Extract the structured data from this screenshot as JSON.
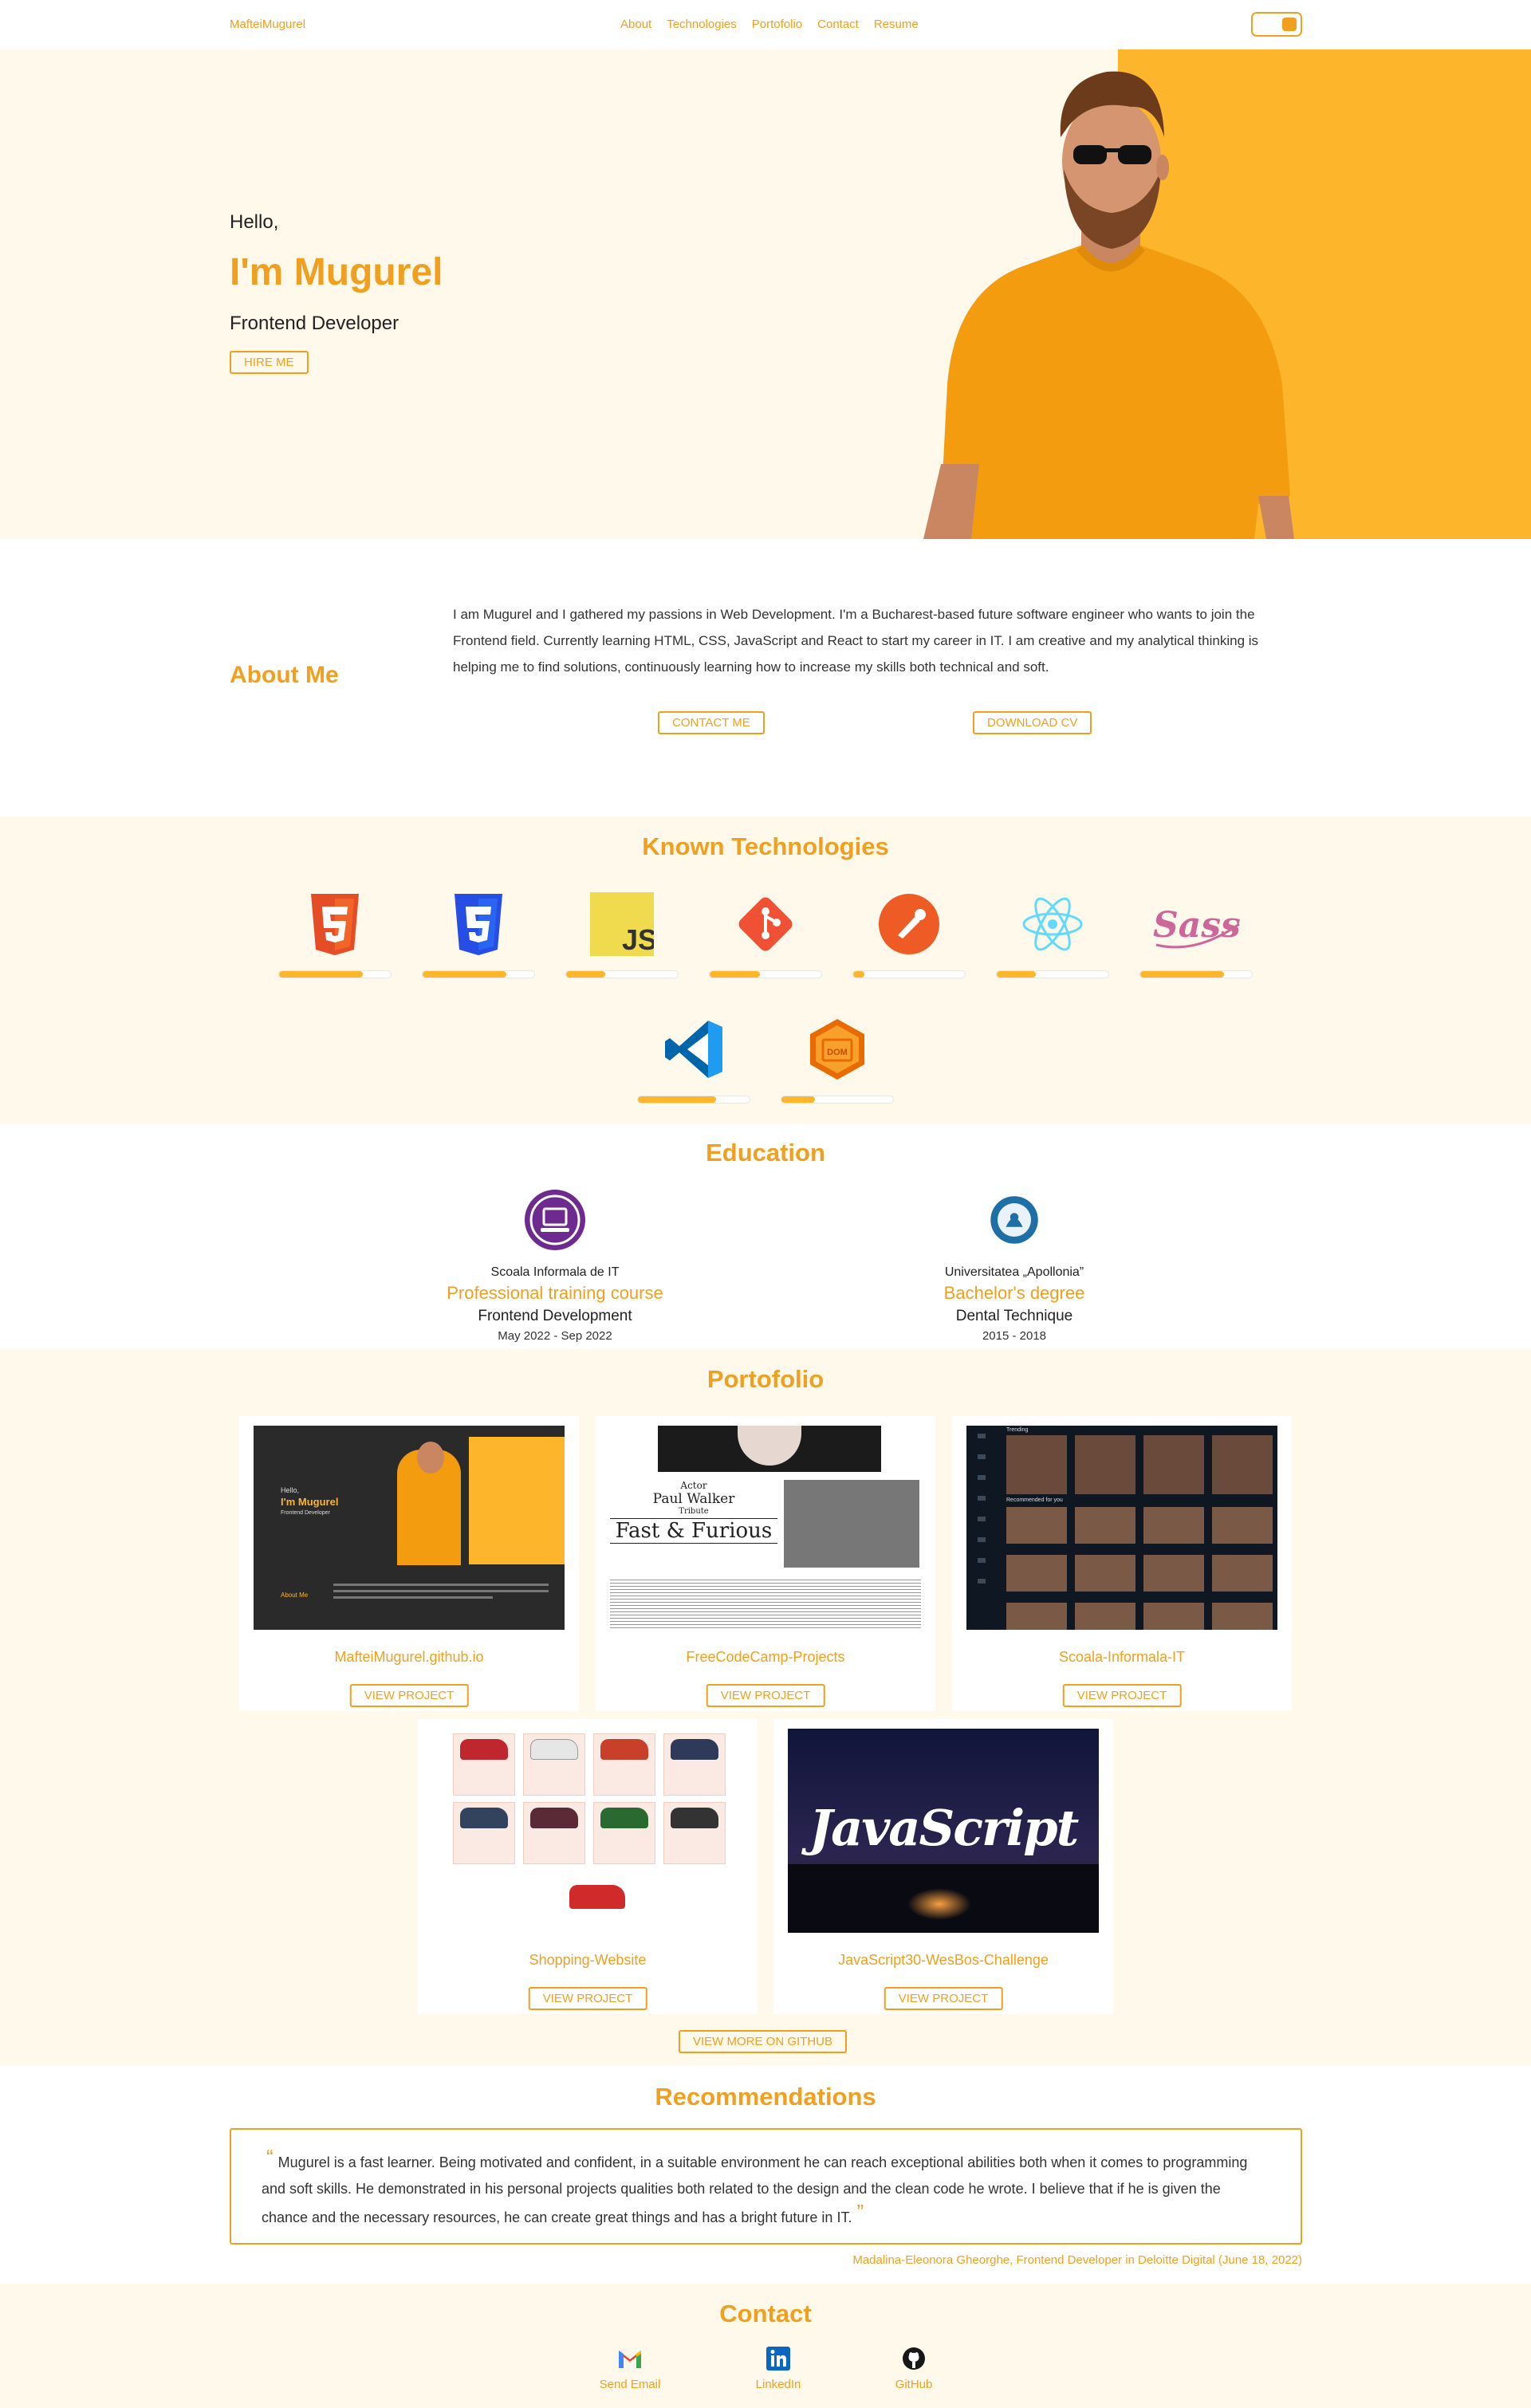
{
  "nav": {
    "brand": "MafteiMugurel",
    "links": [
      "About",
      "Technologies",
      "Portofolio",
      "Contact",
      "Resume"
    ]
  },
  "hero": {
    "greeting": "Hello,",
    "name": "I'm Mugurel",
    "role": "Frontend Developer",
    "hire_label": "HIRE ME"
  },
  "about": {
    "title": "About Me",
    "text": "I am Mugurel and I gathered my passions in Web Development. I'm a Bucharest-based future software engineer who wants to join the Frontend field. Currently learning HTML, CSS, JavaScript and React to start my career in IT. I am creative and my analytical thinking is helping me to find solutions, continuously learning how to increase my skills both technical and soft.",
    "contact_label": "CONTACT ME",
    "cv_label": "DOWNLOAD CV"
  },
  "technologies": {
    "title": "Known Technologies",
    "items": [
      {
        "icon": "html5-icon",
        "level": 0.75
      },
      {
        "icon": "css3-icon",
        "level": 0.75
      },
      {
        "icon": "javascript-icon",
        "level": 0.35
      },
      {
        "icon": "git-icon",
        "level": 0.45
      },
      {
        "icon": "postman-icon",
        "level": 0.1
      },
      {
        "icon": "react-icon",
        "level": 0.35
      },
      {
        "icon": "sass-icon",
        "level": 0.75
      },
      {
        "icon": "vscode-icon",
        "level": 0.7
      },
      {
        "icon": "dom-icon",
        "level": 0.3
      }
    ]
  },
  "education": {
    "title": "Education",
    "items": [
      {
        "school": "Scoala Informala de IT",
        "degree": "Professional training course",
        "field": "Frontend Development",
        "dates": "May 2022 - Sep 2022"
      },
      {
        "school": "Universitatea „Apollonia”",
        "degree": "Bachelor's degree",
        "field": "Dental Technique",
        "dates": "2015 - 2018"
      }
    ]
  },
  "portfolio": {
    "title": "Portofolio",
    "projects": [
      {
        "name": "MafteiMugurel.github.io",
        "button": "VIEW PROJECT"
      },
      {
        "name": "FreeCodeCamp-Projects",
        "button": "VIEW PROJECT"
      },
      {
        "name": "Scoala-Informala-IT",
        "button": "VIEW PROJECT"
      },
      {
        "name": "Shopping-Website",
        "button": "VIEW PROJECT"
      },
      {
        "name": "JavaScript30-WesBos-Challenge",
        "button": "VIEW PROJECT"
      }
    ],
    "more_label": "VIEW MORE ON GITHUB",
    "previews": {
      "site": {
        "hello": "Hello,",
        "name": "I'm Mugurel",
        "role": "Frontend Developer",
        "about": "About Me"
      },
      "tribute": {
        "actor": "Actor",
        "person": "Paul Walker",
        "tribute": "Tribute",
        "film": "Fast & Furious"
      },
      "stream": {
        "trending": "Trending",
        "recommended": "Recommended for you"
      },
      "js_word": "JavaScript"
    }
  },
  "recommendations": {
    "title": "Recommendations",
    "text": "Mugurel is a fast learner. Being motivated and confident, in a suitable environment he can reach exceptional abilities both when it comes to programming and soft skills. He demonstrated in his personal projects qualities both related to the design and the clean code he wrote. I believe that if he is given the chance and the necessary resources, he can create great things and has a bright future in IT.",
    "author": "Madalina-Eleonora Gheorghe, Frontend Developer in Deloitte Digital (June 18, 2022)"
  },
  "contact": {
    "title": "Contact",
    "items": [
      {
        "label": "Send Email",
        "icon": "gmail-icon"
      },
      {
        "label": "LinkedIn",
        "icon": "linkedin-icon"
      },
      {
        "label": "GitHub",
        "icon": "github-icon"
      }
    ]
  },
  "colors": {
    "accent": "#f0a01e",
    "hero_block": "#fdb52c",
    "cream": "#fff9ec"
  }
}
